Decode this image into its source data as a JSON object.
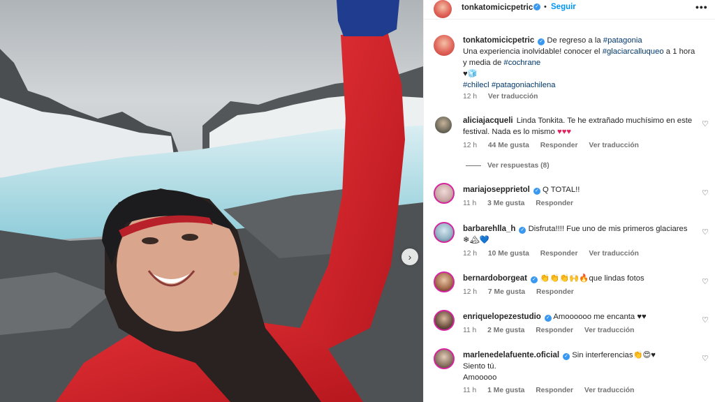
{
  "post": {
    "author": "tonkatomicicpetric",
    "follow_label": "Seguir",
    "more_label": "•••",
    "dot": "•",
    "caption_line1": "De regreso a la",
    "hashtag1": "#patagonia",
    "caption_line2": "Una experiencia inolvidable! conocer el",
    "hashtag2": "#glaciarcalluqueo",
    "caption_line3": "a 1 hora y media de",
    "hashtag3": "#cochrane",
    "caption_emoji": "♥🧊",
    "hashtag4": "#chilecl",
    "hashtag5": "#patagoniachilena",
    "time": "12 h",
    "translate_label": "Ver traducción"
  },
  "comments": [
    {
      "user": "aliciajacqueli",
      "verified": false,
      "text": "Linda Tonkita. Te he extrañado muchísimo en este festival. Nada es lo mismo",
      "emoji": "♥♥♥",
      "time": "12 h",
      "likes": "44 Me gusta",
      "reply": "Responder",
      "translate": "Ver traducción",
      "view_replies": "Ver respuestas (8)"
    },
    {
      "user": "mariajosepprietol",
      "verified": true,
      "text": "Q TOTAL!!",
      "time": "11 h",
      "likes": "3 Me gusta",
      "reply": "Responder"
    },
    {
      "user": "barbarehlla_h",
      "verified": true,
      "text": "Disfruta!!!! Fue uno de mis primeros glaciares",
      "emoji": "❄🏔💙",
      "time": "12 h",
      "likes": "10 Me gusta",
      "reply": "Responder",
      "translate": "Ver traducción"
    },
    {
      "user": "bernardoborgeat",
      "verified": true,
      "emoji": "👏👏👏🙌🔥",
      "text": "que lindas fotos",
      "time": "12 h",
      "likes": "7 Me gusta",
      "reply": "Responder"
    },
    {
      "user": "enriquelopezestudio",
      "verified": true,
      "text": "Amoooooo me encanta",
      "emoji": "♥♥",
      "time": "11 h",
      "likes": "2 Me gusta",
      "reply": "Responder",
      "translate": "Ver traducción"
    },
    {
      "user": "marlenedelafuente.oficial",
      "verified": true,
      "text": "Sin interferencias",
      "emoji": "👏😍♥",
      "text2": "Siento tú.",
      "text3": "Amooooo",
      "time": "11 h",
      "likes": "1 Me gusta",
      "reply": "Responder",
      "translate": "Ver traducción"
    }
  ],
  "icons": {
    "heart": "♡",
    "next": "›",
    "verified": "✓"
  },
  "colors": {
    "link_blue": "#0095f6",
    "hashtag": "#00376b",
    "verified": "#3897f0",
    "meta": "#737373",
    "jacket_red": "#d8232a"
  }
}
